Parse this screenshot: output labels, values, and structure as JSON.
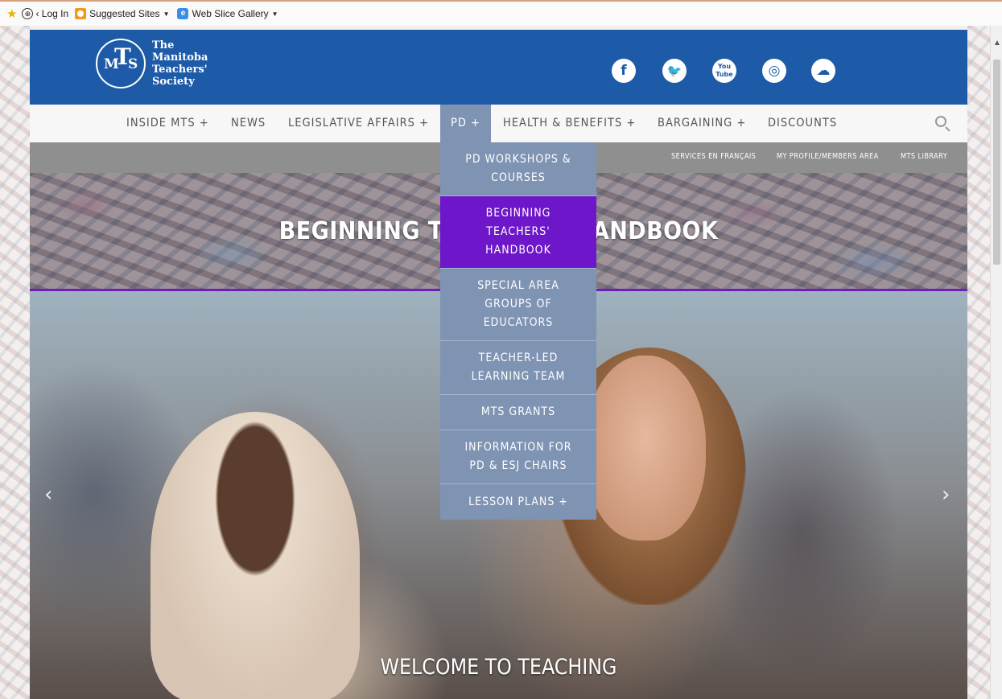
{
  "favorites_bar": {
    "login": "‹ Log In",
    "suggested_sites": "Suggested Sites",
    "web_slice_gallery": "Web Slice Gallery"
  },
  "logo": {
    "mark": {
      "m": "M",
      "t": "T",
      "s": "S"
    },
    "lines": [
      "The",
      "Manitoba",
      "Teachers'",
      "Society"
    ]
  },
  "social": [
    {
      "name": "facebook-icon",
      "glyph": "f"
    },
    {
      "name": "twitter-icon",
      "glyph": "🐦"
    },
    {
      "name": "youtube-icon",
      "glyph": "You\nTube"
    },
    {
      "name": "instagram-icon",
      "glyph": "◎"
    },
    {
      "name": "soundcloud-icon",
      "glyph": "☁"
    }
  ],
  "nav": {
    "items": [
      "INSIDE MTS +",
      "NEWS",
      "LEGISLATIVE AFFAIRS +",
      "PD +",
      "HEALTH & BENEFITS +",
      "BARGAINING +",
      "DISCOUNTS"
    ]
  },
  "utility": {
    "links": [
      "SERVICES EN FRANÇAIS",
      "MY PROFILE/MEMBERS AREA",
      "MTS LIBRARY"
    ]
  },
  "banner": {
    "title": "BEGINNING TEACHERS' HANDBOOK"
  },
  "dropdown": {
    "items": [
      "PD WORKSHOPS &\nCOURSES",
      "BEGINNING\nTEACHERS'\nHANDBOOK",
      "SPECIAL AREA\nGROUPS OF\nEDUCATORS",
      "TEACHER-LED\nLEARNING TEAM",
      "MTS GRANTS",
      "INFORMATION FOR\nPD & ESJ CHAIRS",
      "LESSON PLANS +"
    ]
  },
  "hero": {
    "caption": "WELCOME TO TEACHING",
    "prev": "‹",
    "next": "›"
  },
  "colors": {
    "header_blue": "#1d5aa8",
    "active_purple": "#6e16c9",
    "dropdown_slate": "#7f93b3"
  }
}
